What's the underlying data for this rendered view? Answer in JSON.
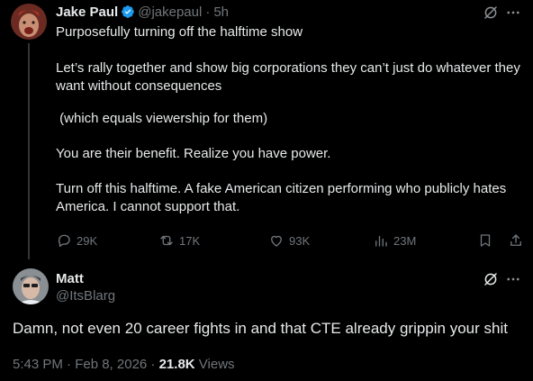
{
  "tweet": {
    "author_name": "Jake Paul",
    "handle": "@jakepaul",
    "time_sep": "·",
    "time": "5h",
    "paragraphs": [
      "Purposefully turning off the halftime show",
      "Let’s rally together and show big corporations they can’t just do whatever they want without consequences",
      " (which equals viewership for them)",
      "You are their benefit. Realize you have power.",
      "Turn off this halftime. A fake American citizen performing who publicly hates America. I cannot support that."
    ],
    "actions": {
      "replies": "29K",
      "reposts": "17K",
      "likes": "93K",
      "views": "23M"
    }
  },
  "reply": {
    "author_name": "Matt",
    "handle": "@ItsBlarg",
    "text": "Damn, not even 20 career fights in and that CTE already grippin your shit",
    "timestamp": "5:43 PM · Feb 8, 2026 ·",
    "views_count": "21.8K",
    "views_label": "Views"
  },
  "colors": {
    "background": "#000000",
    "text": "#e7e9ea",
    "muted": "#71767b",
    "verified": "#1d9bf0"
  },
  "icons": [
    "verified-badge-icon",
    "grok-icon",
    "more-icon",
    "reply-icon",
    "repost-icon",
    "like-icon",
    "views-icon",
    "bookmark-icon",
    "share-icon"
  ]
}
